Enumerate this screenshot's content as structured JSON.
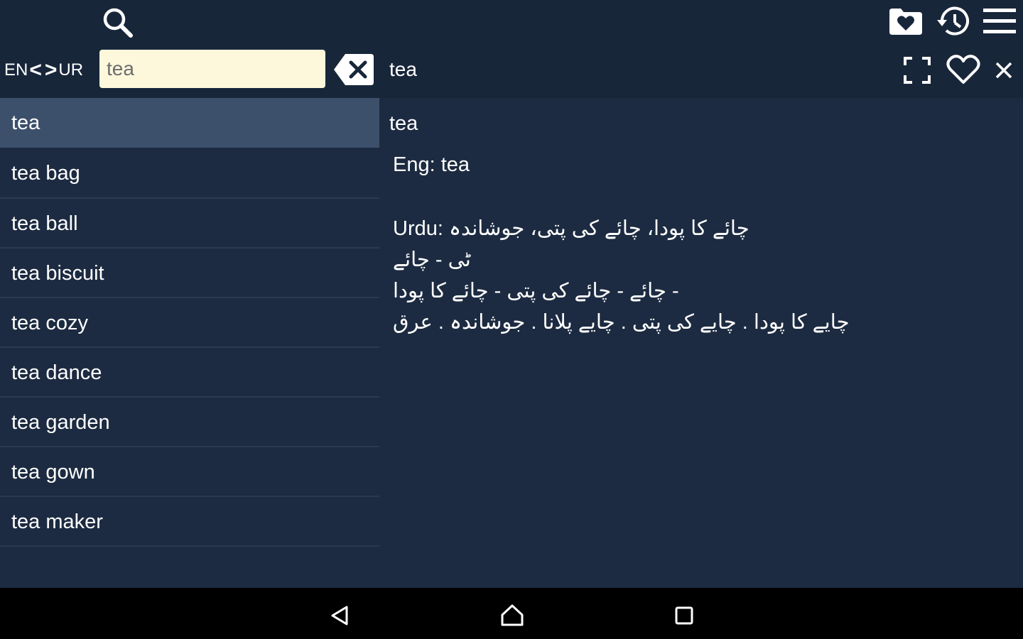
{
  "toolbar": {
    "icons": [
      "search-icon",
      "favorites-folder-icon",
      "history-icon",
      "menu-icon"
    ]
  },
  "lang": {
    "source": "EN",
    "target": "UR",
    "left_arrow": "<",
    "right_arrow": ">"
  },
  "search": {
    "value": "tea",
    "placeholder": ""
  },
  "header": {
    "word": "tea",
    "icons": [
      "fullscreen-icon",
      "favorite-heart-icon",
      "close-icon"
    ]
  },
  "word_list": [
    "tea",
    "tea bag",
    "tea ball",
    "tea biscuit",
    "tea cozy",
    "tea dance",
    "tea garden",
    "tea gown",
    "tea maker"
  ],
  "detail": {
    "title": "tea",
    "eng": "Eng: tea",
    "urdu_lines": [
      "Urdu: چائے کا پودا، چائے کی پتی، جوشاندہ",
      "ٹی - چائے",
      "چائے - چائے کی پتی - چائے کا پودا -",
      "چایے کا پودا . چایے کی پتی . چایے پلانا . جوشاندہ . عرق"
    ]
  },
  "colors": {
    "topbar": "#18263a",
    "background": "#1c2b41",
    "selected_row": "#3c4f6b",
    "search_bg": "#fdf8dc",
    "navbar": "#000000"
  },
  "navbar": {
    "icons": [
      "back-icon",
      "home-icon",
      "recents-icon"
    ]
  }
}
